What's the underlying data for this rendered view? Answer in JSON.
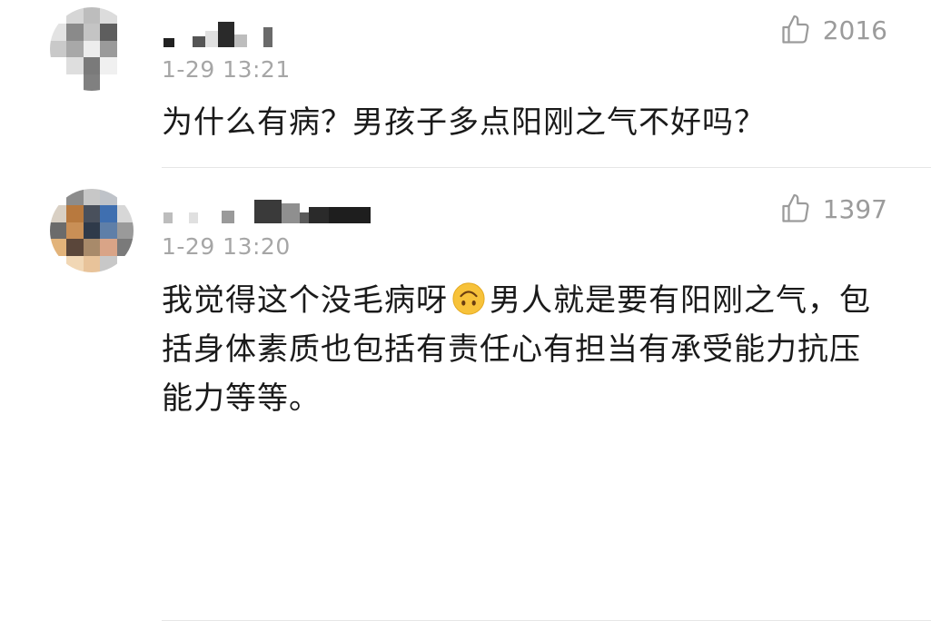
{
  "comments": [
    {
      "username": "",
      "timestamp": "1-29 13:21",
      "like_count": "2016",
      "text": "为什么有病？男孩子多点阳刚之气不好吗？"
    },
    {
      "username": "",
      "timestamp": "1-29 13:20",
      "like_count": "1397",
      "text_before_emoji": "我觉得这个没毛病呀",
      "emoji": "upside-down-face-emoji",
      "text_after_emoji": "男人就是要有阳刚之气，包括身体素质也包括有责任心有担当有承受能力抗压能力等等。"
    }
  ],
  "colors": {
    "text": "#1a1a1a",
    "timestamp": "#a6a6a6",
    "like": "#9b9b9b",
    "divider": "#e6e6e6",
    "background": "#ffffff"
  },
  "icons": {
    "like": "thumbs-up-icon"
  }
}
